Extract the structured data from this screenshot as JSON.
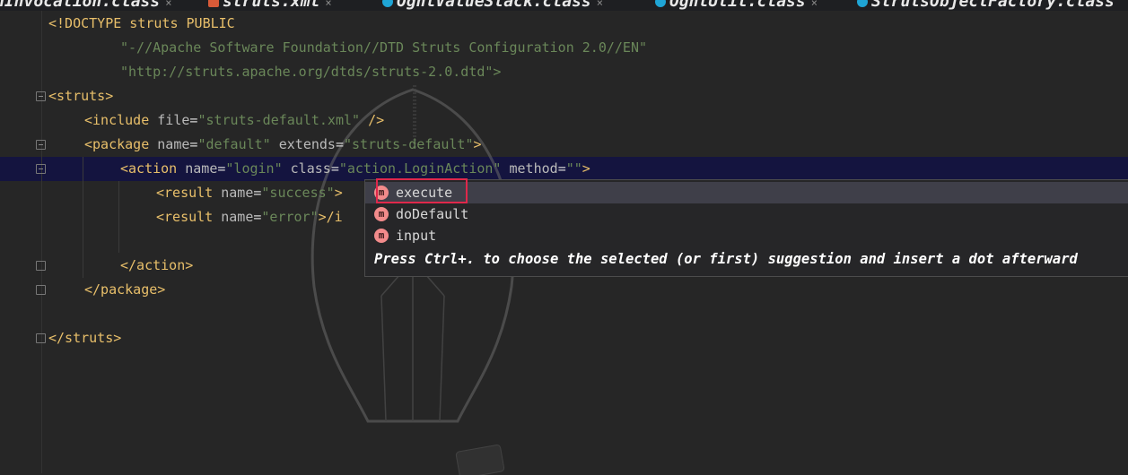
{
  "tabs": [
    {
      "label": "nInvocation.class",
      "active": false
    },
    {
      "label": "struts.xml",
      "active": true
    },
    {
      "label": "OgnlValueStack.class",
      "active": false
    },
    {
      "label": "OgnlUtil.class",
      "active": false
    },
    {
      "label": "StrutsObjectFactory.class",
      "active": false
    }
  ],
  "code": {
    "doctype": "<!DOCTYPE struts PUBLIC",
    "public_id": "\"-//Apache Software Foundation//DTD Struts Configuration 2.0//EN\"",
    "system_id": "\"http://struts.apache.org/dtds/struts-2.0.dtd\">",
    "struts_open": "<struts>",
    "include_tag": "<include",
    "include_attr": "file",
    "include_val": "\"struts-default.xml\"",
    "include_close": "/>",
    "package_tag": "<package",
    "package_name_attr": "name",
    "package_name_val": "\"default\"",
    "package_extends_attr": "extends",
    "package_extends_val": "\"struts-default\"",
    "package_close": ">",
    "action_tag": "<action",
    "action_name_attr": "name",
    "action_name_val": "\"login\"",
    "action_class_attr": "class",
    "action_class_val": "\"action.LoginAction\"",
    "action_method_attr": "method",
    "action_method_val": "\"\"",
    "action_close": ">",
    "result1_tag": "<result",
    "result1_attr": "name",
    "result1_val": "\"success\"",
    "result1_rest": ">",
    "result2_tag": "<result",
    "result2_attr": "name",
    "result2_val": "\"error\"",
    "result2_rest": ">/i",
    "action_end": "</action>",
    "package_end": "</package>",
    "struts_end": "</struts>"
  },
  "completion": {
    "items": [
      {
        "icon": "m",
        "label": "execute",
        "selected": true
      },
      {
        "icon": "m",
        "label": "doDefault",
        "selected": false
      },
      {
        "icon": "m",
        "label": "input",
        "selected": false
      }
    ],
    "hint": "Press Ctrl+. to choose the selected (or first) suggestion and insert a dot afterward"
  }
}
